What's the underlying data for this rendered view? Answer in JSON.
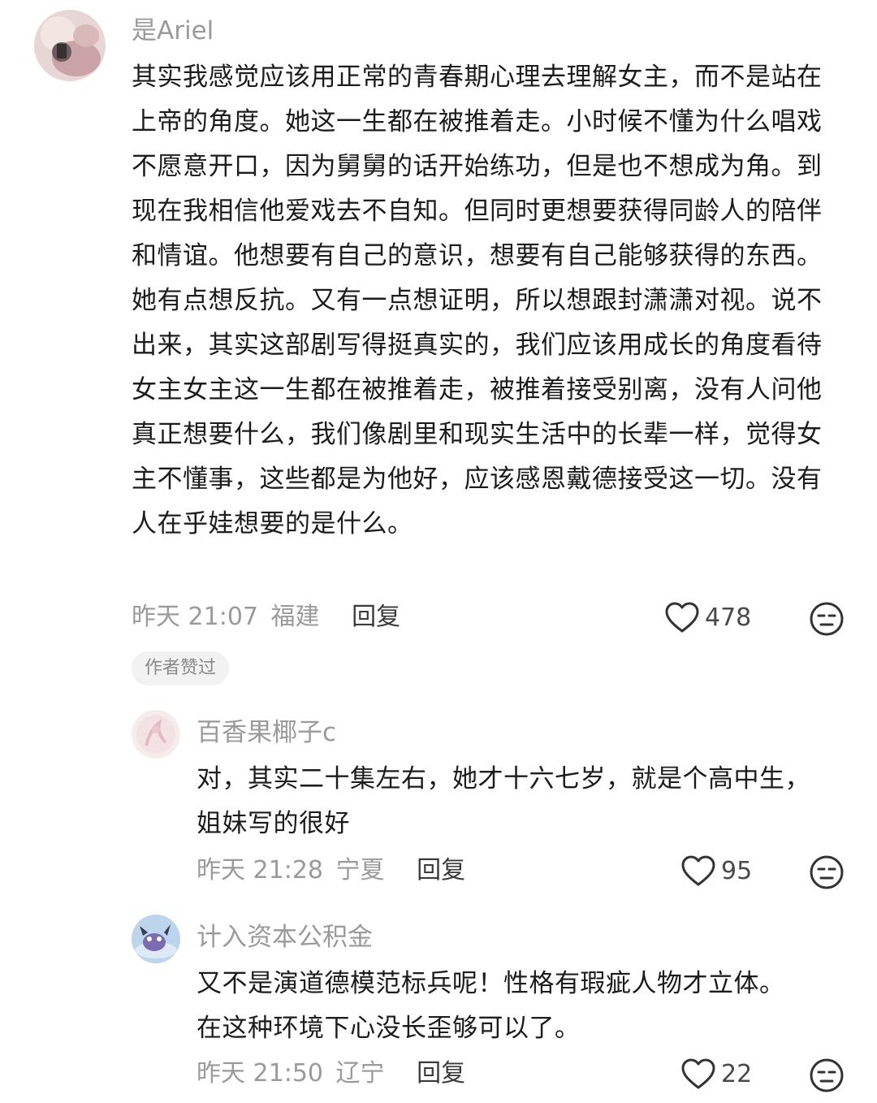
{
  "main_comment": {
    "username": "是Ariel",
    "text": "其实我感觉应该用正常的青春期心理去理解女主，而不是站在上帝的角度。她这一生都在被推着走。小时候不懂为什么唱戏不愿意开口，因为舅舅的话开始练功，但是也不想成为角。到现在我相信他爱戏去不自知。但同时更想要获得同龄人的陪伴和情谊。他想要有自己的意识，想要有自己能够获得的东西。她有点想反抗。又有一点想证明，所以想跟封潇潇对视。说不出来，其实这部剧写得挺真实的，我们应该用成长的角度看待女主女主这一生都在被推着走，被推着接受别离，没有人问他真正想要什么，我们像剧里和现实生活中的长辈一样，觉得女主不懂事，这些都是为他好，应该感恩戴德接受这一切。没有人在乎娃想要的是什么。",
    "time": "昨天 21:07",
    "location": "福建",
    "reply_label": "回复",
    "likes": "478",
    "badge": "作者赞过"
  },
  "replies": [
    {
      "username": "百香果椰子c",
      "text": "对，其实二十集左右，她才十六七岁，就是个高中生，姐妹写的很好",
      "time": "昨天 21:28",
      "location": "宁夏",
      "reply_label": "回复",
      "likes": "95"
    },
    {
      "username": "计入资本公积金",
      "text": "又不是演道德模范标兵呢！性格有瑕疵人物才立体。在这种环境下心没长歪够可以了。",
      "time": "昨天 21:50",
      "location": "辽宁",
      "reply_label": "回复",
      "likes": "22"
    }
  ],
  "icons": {
    "like": "heart-outline-icon",
    "dislike": "unimpressed-face-icon"
  }
}
